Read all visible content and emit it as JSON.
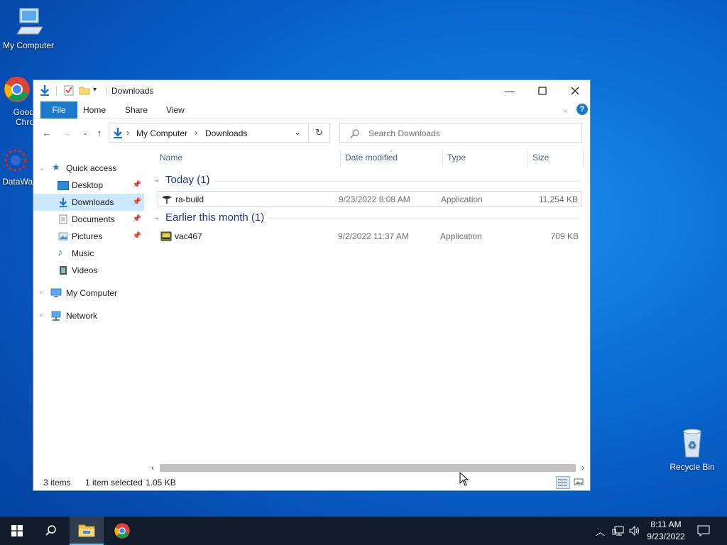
{
  "desktop": {
    "icons": [
      {
        "label": "My Computer"
      },
      {
        "label": "Good Chro"
      },
      {
        "label": "DataWa"
      },
      {
        "label": "Recycle Bin"
      }
    ]
  },
  "window": {
    "title": "Downloads",
    "ribbon": {
      "file": "File",
      "home": "Home",
      "share": "Share",
      "view": "View"
    },
    "address": {
      "crumbs": [
        "My Computer",
        "Downloads"
      ]
    },
    "search": {
      "placeholder": "Search Downloads"
    },
    "navpane": {
      "quick_access": "Quick access",
      "items": [
        "Desktop",
        "Downloads",
        "Documents",
        "Pictures",
        "Music",
        "Videos"
      ],
      "my_computer": "My Computer",
      "network": "Network"
    },
    "columns": {
      "name": "Name",
      "date": "Date modified",
      "type": "Type",
      "size": "Size"
    },
    "groups": [
      {
        "label": "Today (1)",
        "files": [
          {
            "name": "ra-build",
            "date": "9/23/2022 8:08 AM",
            "type": "Application",
            "size": "11,254 KB"
          }
        ]
      },
      {
        "label": "Earlier this month (1)",
        "files": [
          {
            "name": "vac467",
            "date": "9/2/2022 11:37 AM",
            "type": "Application",
            "size": "709 KB"
          }
        ]
      }
    ],
    "status": {
      "items": "3 items",
      "selected": "1 item selected",
      "size": "1.05 KB"
    }
  },
  "taskbar": {
    "time": "8:11 AM",
    "date": "9/23/2022"
  },
  "colors": {
    "accent": "#1979ca",
    "selection": "#cce8ff",
    "taskbar": "#101c2b",
    "group_text": "#1e3287"
  }
}
